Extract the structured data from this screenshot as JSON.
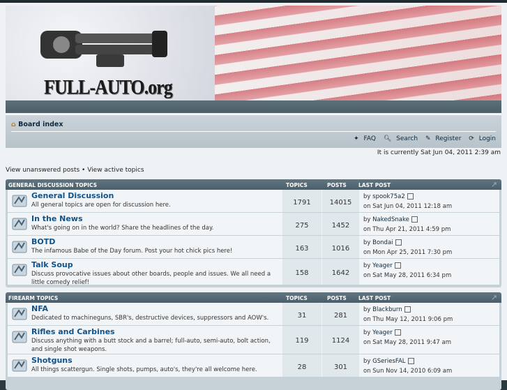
{
  "site": {
    "logo_text": "FULL-AUTO.org"
  },
  "navbar": {
    "board_index": "Board index",
    "links": [
      {
        "icon": "faq-icon",
        "label": "FAQ"
      },
      {
        "icon": "search-icon",
        "label": "Search"
      },
      {
        "icon": "register-icon",
        "label": "Register"
      },
      {
        "icon": "login-icon",
        "label": "Login"
      }
    ]
  },
  "currently": "It is currently Sat Jun 04, 2011 2:39 am",
  "view_links": "View unanswered posts • View active topics",
  "sections": [
    {
      "title": "GENERAL DISCUSSION TOPICS",
      "col_topics": "TOPICS",
      "col_posts": "POSTS",
      "col_last": "LAST POST",
      "forums": [
        {
          "name": "General Discussion",
          "desc": "All general topics are open for discussion here.",
          "topics": "1791",
          "posts": "14015",
          "by_label": "by",
          "by": "spook75a2",
          "on": "on Sat Jun 04, 2011 12:18 am"
        },
        {
          "name": "In the News",
          "desc": "What's going on in the world? Share the headlines of the day.",
          "topics": "275",
          "posts": "1452",
          "by_label": "by",
          "by": "NakedSnake",
          "on": "on Thu Apr 21, 2011 4:59 pm"
        },
        {
          "name": "BOTD",
          "desc": "The infamous Babe of the Day forum. Post your hot chick pics here!",
          "topics": "163",
          "posts": "1016",
          "by_label": "by",
          "by": "Bondai",
          "on": "on Mon Apr 25, 2011 7:30 pm"
        },
        {
          "name": "Talk Soup",
          "desc": "Discuss provocative issues about other boards, people and issues. We all need a little comedy relief!",
          "topics": "158",
          "posts": "1642",
          "by_label": "by",
          "by": "Yeager",
          "on": "on Sat May 28, 2011 6:34 pm"
        }
      ]
    },
    {
      "title": "FIREARM TOPICS",
      "col_topics": "TOPICS",
      "col_posts": "POSTS",
      "col_last": "LAST POST",
      "forums": [
        {
          "name": "NFA",
          "desc": "Dedicated to machineguns, SBR's, destructive devices, suppressors and AOW's.",
          "topics": "31",
          "posts": "281",
          "by_label": "by",
          "by": "Blackburn",
          "on": "on Thu May 12, 2011 9:06 pm"
        },
        {
          "name": "Rifles and Carbines",
          "desc": "Discuss anything with a butt stock and a barrel; full-auto, semi-auto, bolt action, and single shot weapons.",
          "topics": "119",
          "posts": "1124",
          "by_label": "by",
          "by": "Yeager",
          "on": "on Sat May 28, 2011 9:47 am"
        },
        {
          "name": "Shotguns",
          "desc": "All things scattergun. Single shots, pumps, auto's, they're all welcome here.",
          "topics": "28",
          "posts": "301",
          "by_label": "by",
          "by": "GSeriesFAL",
          "on": "on Sun Nov 14, 2010 6:09 am"
        }
      ]
    }
  ]
}
